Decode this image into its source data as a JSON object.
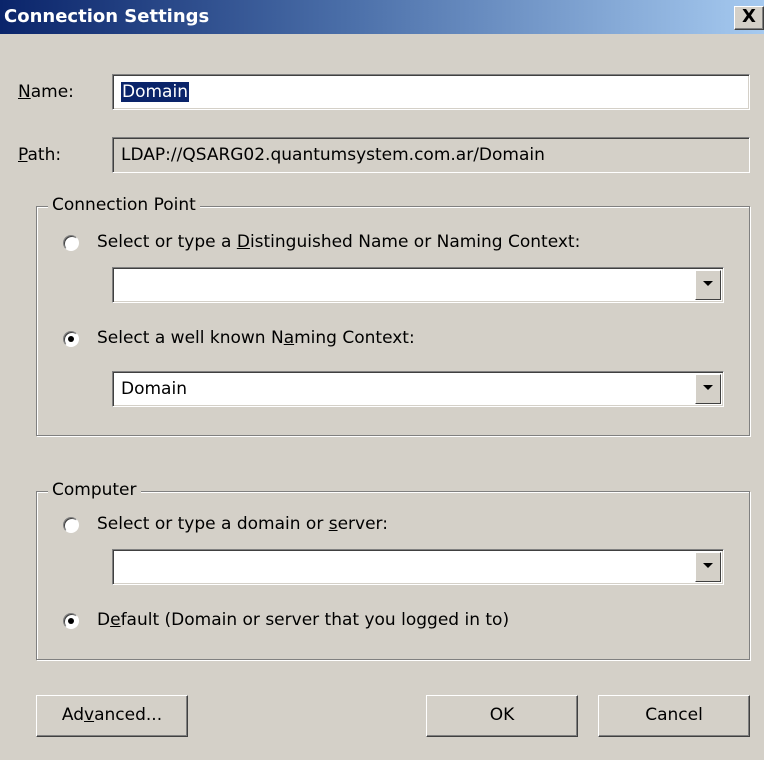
{
  "window": {
    "title": "Connection Settings",
    "close_glyph": "X"
  },
  "name_field": {
    "label_accel": "N",
    "label_rest": "ame:",
    "value": "Domain"
  },
  "path_field": {
    "label_accel": "P",
    "label_rest": "ath:",
    "value": "LDAP://QSARG02.quantumsystem.com.ar/Domain"
  },
  "connection_point": {
    "title": "Connection Point",
    "option_dn": {
      "pre": "Select or type a ",
      "accel": "D",
      "post": "istinguished Name or Naming Context:",
      "selected": false
    },
    "dn_combo_value": "",
    "option_well_known": {
      "pre": "Select a well known N",
      "accel": "a",
      "post": "ming Context:",
      "selected": true
    },
    "well_known_combo_value": "Domain"
  },
  "computer": {
    "title": "Computer",
    "option_server": {
      "pre": "Select or type a domain or ",
      "accel": "s",
      "post": "erver:",
      "selected": false
    },
    "server_combo_value": "",
    "option_default": {
      "pre": "D",
      "accel": "e",
      "post": "fault (Domain or server that you logged in to)",
      "selected": true
    }
  },
  "buttons": {
    "advanced_pre": "Ad",
    "advanced_accel": "v",
    "advanced_post": "anced...",
    "ok": "OK",
    "cancel": "Cancel"
  },
  "icons": {
    "close": "close-icon",
    "dropdown": "dropdown-arrow-icon",
    "radio": "radio-button"
  }
}
